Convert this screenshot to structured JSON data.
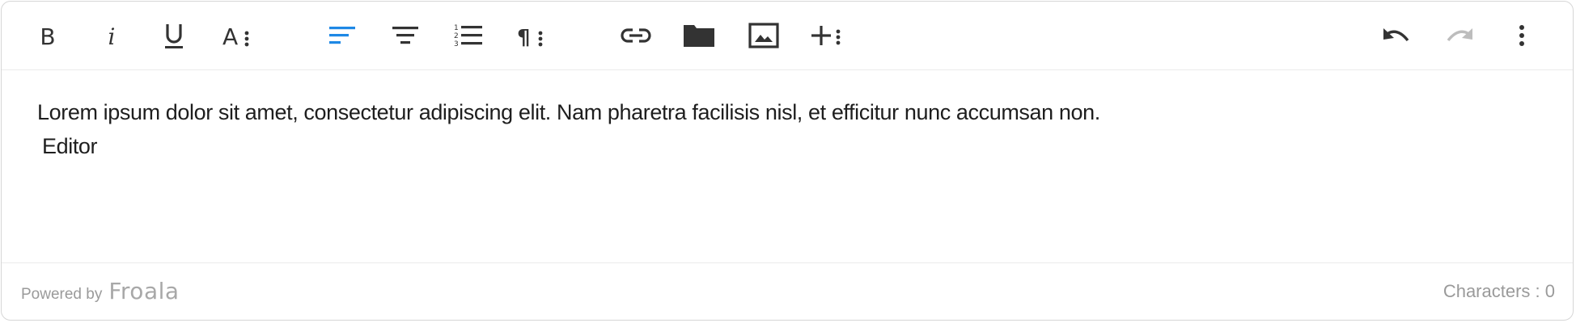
{
  "toolbar": {
    "buttons": [
      {
        "name": "bold",
        "icon": "bold-icon",
        "glyph": "B"
      },
      {
        "name": "italic",
        "icon": "italic-icon",
        "glyph": "i"
      },
      {
        "name": "underline",
        "icon": "underline-icon",
        "glyph": "U"
      },
      {
        "name": "text-format-more",
        "icon": "text-format-more-icon",
        "glyph": "A"
      },
      {
        "name": "align-left",
        "icon": "align-left-icon",
        "active": true
      },
      {
        "name": "align-center",
        "icon": "align-center-icon"
      },
      {
        "name": "ordered-list",
        "icon": "ordered-list-icon"
      },
      {
        "name": "paragraph-more",
        "icon": "paragraph-more-icon",
        "glyph": "¶"
      },
      {
        "name": "insert-link",
        "icon": "link-icon"
      },
      {
        "name": "insert-file",
        "icon": "folder-icon"
      },
      {
        "name": "insert-image",
        "icon": "image-icon"
      },
      {
        "name": "insert-more",
        "icon": "plus-more-icon"
      },
      {
        "name": "undo",
        "icon": "undo-icon"
      },
      {
        "name": "redo",
        "icon": "redo-icon",
        "disabled": true
      },
      {
        "name": "more-options",
        "icon": "vertical-dots-icon"
      }
    ],
    "colors": {
      "icon": "#333333",
      "active": "#1e88e5",
      "disabled": "#bdbdbd"
    }
  },
  "content": {
    "line1": "Lorem ipsum dolor sit amet, consectetur adipiscing elit. Nam pharetra facilisis nisl, et efficitur nunc accumsan non.",
    "line2": "Editor"
  },
  "footer": {
    "powered_by": "Powered by",
    "brand": "Froala",
    "characters": "Characters : 0"
  }
}
